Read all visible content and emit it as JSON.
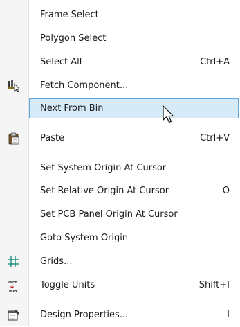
{
  "menu": {
    "items": [
      {
        "label": "Frame Select",
        "shortcut": ""
      },
      {
        "label": "Polygon Select",
        "shortcut": ""
      },
      {
        "label": "Select All",
        "shortcut": "Ctrl+A"
      },
      {
        "label": "Fetch Component...",
        "shortcut": "",
        "icon": "fetch-component-icon"
      },
      {
        "label": "Next From Bin",
        "shortcut": "",
        "highlighted": true
      },
      {
        "label": "Paste",
        "shortcut": "Ctrl+V",
        "icon": "clipboard-paste-icon"
      },
      {
        "label": "Set System Origin At Cursor",
        "shortcut": ""
      },
      {
        "label": "Set Relative Origin At Cursor",
        "shortcut": "O"
      },
      {
        "label": "Set PCB Panel Origin At Cursor",
        "shortcut": ""
      },
      {
        "label": "Goto System Origin",
        "shortcut": ""
      },
      {
        "label": "Grids...",
        "shortcut": "",
        "icon": "grid-icon"
      },
      {
        "label": "Toggle Units",
        "shortcut": "Shift+I",
        "icon": "toggle-units-icon"
      },
      {
        "label": "Design Properties...",
        "shortcut": "I",
        "icon": "design-properties-icon"
      }
    ],
    "toggle_units_icon_text": {
      "top": "Inch",
      "bottom": "mm"
    },
    "colors": {
      "highlight_bg": "#d6eaf8",
      "highlight_border": "#5fa8dd",
      "gutter": "#f5f5f5",
      "grid_icon": "#1a8a7a"
    }
  }
}
